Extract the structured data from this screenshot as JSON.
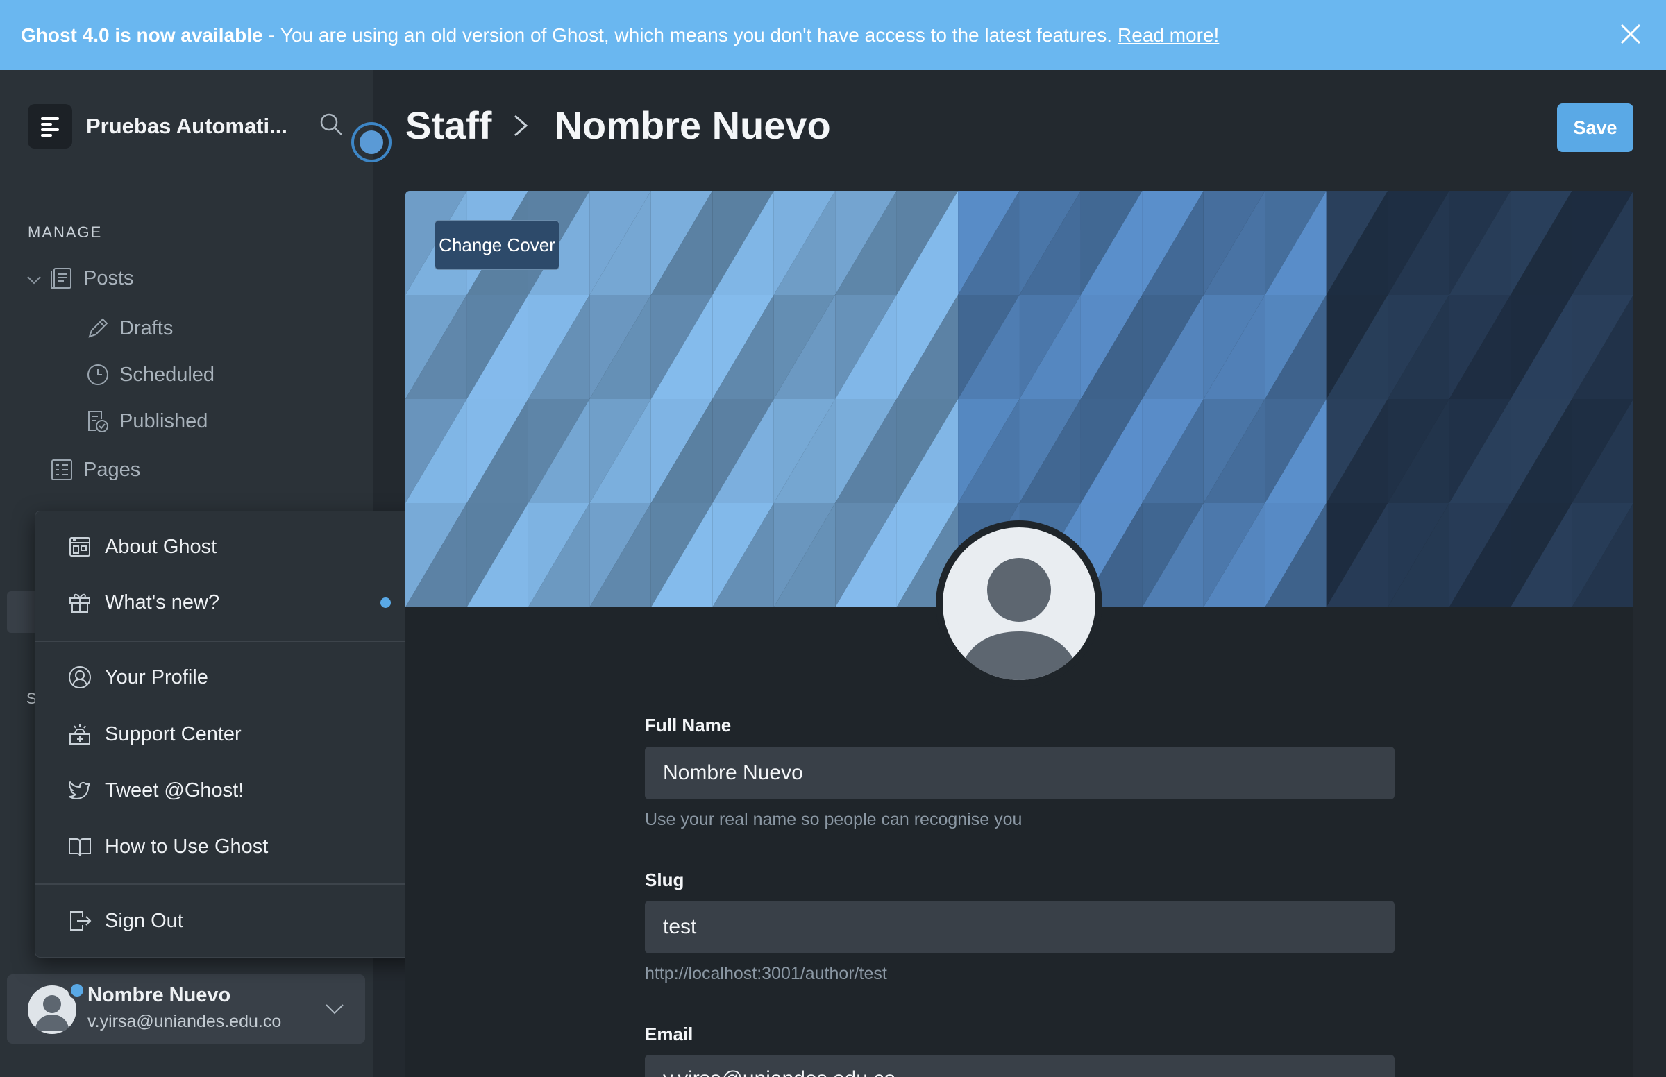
{
  "banner": {
    "title": "Ghost 4.0 is now available",
    "separator": "-",
    "message": "You are using an old version of Ghost, which means you don't have access to the latest features.",
    "link": "Read more!"
  },
  "sidebar": {
    "site_name": "Pruebas Automati...",
    "section_manage": "MANAGE",
    "items": [
      {
        "label": "Posts",
        "icon": "posts-icon"
      },
      {
        "label": "Drafts",
        "icon": "pencil-icon"
      },
      {
        "label": "Scheduled",
        "icon": "clock-icon"
      },
      {
        "label": "Published",
        "icon": "published-icon"
      },
      {
        "label": "Pages",
        "icon": "pages-icon"
      }
    ],
    "hidden_section_initial": "S",
    "user": {
      "name": "Nombre Nuevo",
      "email": "v.yirsa@uniandes.edu.co"
    }
  },
  "dropdown": {
    "items": [
      {
        "label": "About Ghost",
        "icon": "about-icon"
      },
      {
        "label": "What's new?",
        "icon": "gift-icon"
      },
      {
        "label": "Your Profile",
        "icon": "profile-icon"
      },
      {
        "label": "Support Center",
        "icon": "support-icon"
      },
      {
        "label": "Tweet @Ghost!",
        "icon": "twitter-icon"
      },
      {
        "label": "How to Use Ghost",
        "icon": "book-icon"
      },
      {
        "label": "Sign Out",
        "icon": "signout-icon"
      }
    ]
  },
  "header": {
    "crumb_parent": "Staff",
    "crumb_current": "Nombre Nuevo",
    "save_label": "Save"
  },
  "profile": {
    "change_cover": "Change Cover",
    "full_name_label": "Full Name",
    "full_name_value": "Nombre Nuevo",
    "full_name_help": "Use your real name so people can recognise you",
    "slug_label": "Slug",
    "slug_value": "test",
    "slug_help": "http://localhost:3001/author/test",
    "email_label": "Email",
    "email_value": "v.yirsa@uniandes.edu.co"
  },
  "colors": {
    "accent": "#5aa9e6",
    "banner": "#6ab7f0",
    "sidebar_bg": "#2b3238",
    "main_bg": "#23292f"
  }
}
